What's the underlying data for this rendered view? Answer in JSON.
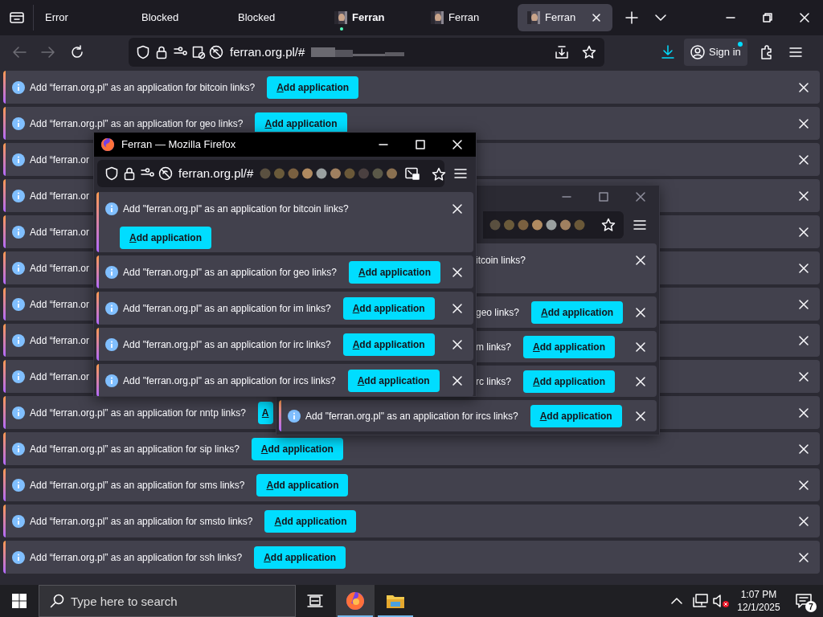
{
  "tabs": [
    {
      "label": "Error",
      "kind": "plain",
      "selected": false,
      "attention": false
    },
    {
      "label": "Blocked",
      "kind": "plain",
      "selected": false,
      "attention": false
    },
    {
      "label": "Blocked",
      "kind": "plain",
      "selected": false,
      "attention": false
    },
    {
      "label": "Ferran",
      "kind": "site",
      "selected": false,
      "attention": true
    },
    {
      "label": "Ferran",
      "kind": "site",
      "selected": false,
      "attention": false
    },
    {
      "label": "Ferran",
      "kind": "site",
      "selected": true,
      "attention": false
    }
  ],
  "toolbar": {
    "back_disabled": true,
    "forward_disabled": true,
    "url": "ferran.org.pl/#",
    "sign_in": "Sign in"
  },
  "notifications": [
    {
      "kind": "inline",
      "text": "Add “ferran.org.pl” as an application for bitcoin links?",
      "button": "Add application"
    },
    {
      "kind": "inline",
      "text": "Add “ferran.org.pl” as an application for geo links?",
      "button": "Add application"
    },
    {
      "kind": "inline",
      "text": "Add “ferran.or"
    },
    {
      "kind": "inline",
      "text": "Add “ferran.or"
    },
    {
      "kind": "inline",
      "text": "Add “ferran.or"
    },
    {
      "kind": "inline",
      "text": "Add “ferran.or"
    },
    {
      "kind": "inline",
      "text": "Add “ferran.or"
    },
    {
      "kind": "inline",
      "text": "Add “ferran.or"
    },
    {
      "kind": "inline",
      "text": "Add “ferran.or"
    },
    {
      "kind": "inline",
      "text": "Add “ferran.org.pl” as an application for nntp links?",
      "button": "A"
    },
    {
      "kind": "inline",
      "text": "Add “ferran.org.pl” as an application for sip links?",
      "button": "Add application"
    },
    {
      "kind": "inline",
      "text": "Add “ferran.org.pl” as an application for sms links?",
      "button": "Add application"
    },
    {
      "kind": "inline",
      "text": "Add “ferran.org.pl” as an application for smsto links?",
      "button": "Add application"
    },
    {
      "kind": "inline",
      "text": "Add “ferran.org.pl” as an application for ssh links?",
      "button": "Add application"
    }
  ],
  "windows": [
    {
      "title": "Ferran — Mozilla Firefox",
      "active": true,
      "url": "ferran.org.pl/#",
      "notifications": [
        {
          "kind": "wrapped",
          "clipped": false,
          "text": "Add \"ferran.org.pl\" as an application for bitcoin links?",
          "button": "Add application"
        },
        {
          "kind": "inline",
          "clipped": false,
          "text": "Add \"ferran.org.pl\" as an application for geo links?",
          "button": "Add application"
        },
        {
          "kind": "inline",
          "clipped": false,
          "text": "Add \"ferran.org.pl\" as an application for im links?",
          "button": "Add application"
        },
        {
          "kind": "inline",
          "clipped": false,
          "text": "Add \"ferran.org.pl\" as an application for irc links?",
          "button": "Add application"
        },
        {
          "kind": "inline",
          "clipped": false,
          "text": "Add \"ferran.org.pl\" as an application for ircs links?",
          "button": "Add application"
        }
      ]
    },
    {
      "active": false,
      "notifications": [
        {
          "kind": "wrapped",
          "clipped": true,
          "text": "itcoin links?"
        },
        {
          "kind": "inline",
          "clipped": true,
          "text": "geo links?",
          "button": "Add application"
        },
        {
          "kind": "inline",
          "clipped": true,
          "text": "m links?",
          "button": "Add application"
        },
        {
          "kind": "inline",
          "clipped": true,
          "text": "rc links?",
          "button": "Add application"
        },
        {
          "kind": "inline",
          "clipped": false,
          "text": "Add \"ferran.org.pl\" as an application for ircs links?",
          "button": "Add application"
        }
      ]
    }
  ],
  "taskbar": {
    "search_placeholder": "Type here to search",
    "apps": [
      {
        "kind": "browser",
        "active": true
      },
      {
        "kind": "folder",
        "active": false
      }
    ],
    "time": "1:07 PM",
    "date": "12/1/2025",
    "notification_count": "7"
  }
}
